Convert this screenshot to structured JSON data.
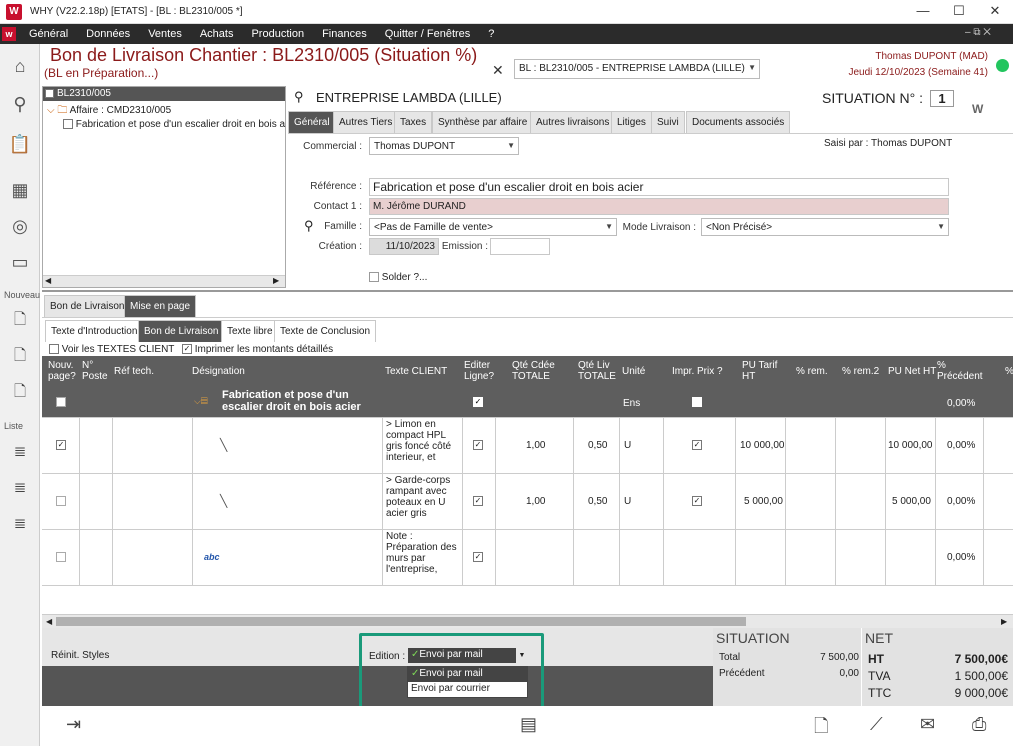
{
  "window": {
    "title": "WHY (V22.2.18p)  [ETATS] - [BL : BL2310/005 *]",
    "logo": "W"
  },
  "menu": [
    "Général",
    "Données",
    "Ventes",
    "Achats",
    "Production",
    "Finances",
    "Quitter / Fenêtres",
    "?"
  ],
  "sidebar": {
    "nouveau_label": "Nouveau",
    "liste_label": "Liste",
    "icons": [
      "home-icon",
      "search-icon",
      "clipboard-icon",
      "calculator-icon",
      "globe-icon",
      "folder-icon"
    ]
  },
  "header": {
    "title": "Bon de Livraison Chantier : BL2310/005 (Situation %)",
    "subtitle": "(BL en Préparation...)",
    "selector": "BL : BL2310/005 - ENTREPRISE LAMBDA  (LILLE)",
    "user": "Thomas DUPONT (MAD)",
    "date": "Jeudi 12/10/2023 (Semaine 41)",
    "status_color": "#22c55e"
  },
  "tree": {
    "root": "BL2310/005",
    "affaire": "Affaire : CMD2310/005",
    "item": "Fabrication et pose d'un escalier droit en bois a"
  },
  "client": {
    "name": "ENTREPRISE LAMBDA  (LILLE)",
    "situation_label": "SITUATION N° :",
    "situation_no": "1"
  },
  "tabs": [
    "Général",
    "Autres Tiers",
    "Taxes",
    "Synthèse par affaire",
    "Autres livraisons",
    "Litiges",
    "Suivi",
    "Documents associés"
  ],
  "form": {
    "commercial_label": "Commercial :",
    "commercial": "Thomas DUPONT",
    "saisi_par": "Saisi par : Thomas DUPONT",
    "reference_label": "Référence :",
    "reference": "Fabrication et pose d'un escalier droit en bois acier",
    "contact_label": "Contact 1 :",
    "contact": "M. Jérôme DURAND",
    "famille_label": "Famille :",
    "famille": "<Pas de Famille de vente>",
    "mode_label": "Mode Livraison :",
    "mode": "<Non Précisé>",
    "creation_label": "Création :",
    "creation": "11/10/2023",
    "emission_label": "Emission :",
    "emission": "",
    "solder_label": "Solder ?..."
  },
  "subtabs": [
    "Bon de Livraison",
    "Mise en page"
  ],
  "pagetabs": [
    "Texte d'Introduction",
    "Bon de Livraison",
    "Texte libre",
    "Texte de Conclusion"
  ],
  "options": {
    "voir_textes": "Voir les TEXTES CLIENT",
    "imprimer_montants": "Imprimer les montants détaillés"
  },
  "grid": {
    "columns": [
      "Nouv. page?",
      "N° Poste",
      "Réf tech.",
      "Désignation",
      "Texte CLIENT",
      "Editer Ligne?",
      "Qté Cdée TOTALE",
      "Qté Liv TOTALE",
      "Unité",
      "Impr. Prix ?",
      "PU Tarif HT",
      "% rem.",
      "% rem.2",
      "PU Net HT",
      "% Précédent",
      "%"
    ],
    "rows": [
      {
        "designation": "Fabrication et pose d'un escalier droit en bois acier",
        "texte": "",
        "qte_cdee": "",
        "qte_liv": "",
        "unite": "Ens",
        "pu_tarif": "",
        "pu_net": "",
        "pct_prec": "0,00%",
        "nouv_page": false,
        "impr": false,
        "editer": true
      },
      {
        "designation": "",
        "texte": "> Limon en compact HPL gris foncé côté interieur, et",
        "qte_cdee": "1,00",
        "qte_liv": "0,50",
        "unite": "U",
        "pu_tarif": "10 000,00",
        "pu_net": "10 000,00",
        "pct_prec": "0,00%",
        "nouv_page": true,
        "impr": true,
        "editer": true
      },
      {
        "designation": "",
        "texte": "> Garde-corps rampant avec poteaux en U acier gris",
        "qte_cdee": "1,00",
        "qte_liv": "0,50",
        "unite": "U",
        "pu_tarif": "5 000,00",
        "pu_net": "5 000,00",
        "pct_prec": "0,00%",
        "nouv_page": false,
        "impr": true,
        "editer": true
      },
      {
        "designation": "",
        "texte": "Note : Préparation des murs par l'entreprise,",
        "qte_cdee": "",
        "qte_liv": "",
        "unite": "",
        "pu_tarif": "",
        "pu_net": "",
        "pct_prec": "0,00%",
        "nouv_page": false,
        "impr": false,
        "editer": true
      }
    ]
  },
  "footer": {
    "reinit": "Réinit. Styles",
    "edition_label": "Edition :",
    "edition_value": "Envoi par mail",
    "dropdown_options": [
      "Envoi par mail",
      "Envoi par courrier"
    ],
    "situation": {
      "title": "SITUATION",
      "total_label": "Total",
      "total": "7 500,00",
      "precedent_label": "Précédent",
      "precedent": "0,00"
    },
    "net": {
      "title": "NET",
      "ht_label": "HT",
      "ht": "7 500,00€",
      "tva_label": "TVA",
      "tva": "1 500,00€",
      "ttc_label": "TTC",
      "ttc": "9 000,00€"
    },
    "highlight_color": "#1a9a7a"
  }
}
